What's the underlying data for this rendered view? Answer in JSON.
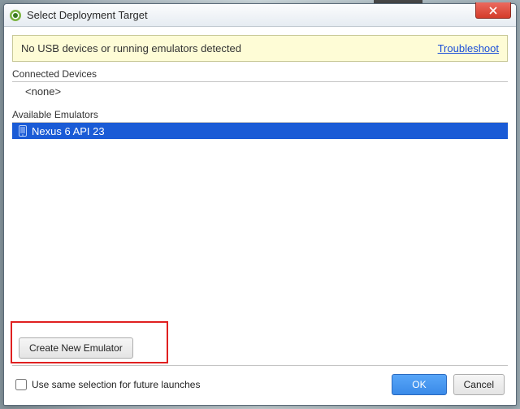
{
  "window": {
    "title": "Select Deployment Target"
  },
  "banner": {
    "message": "No USB devices or running emulators detected",
    "link": "Troubleshoot"
  },
  "sections": {
    "connected": {
      "label": "Connected Devices",
      "none": "<none>"
    },
    "available": {
      "label": "Available Emulators"
    }
  },
  "emulators": [
    {
      "name": "Nexus 6 API 23",
      "selected": true
    }
  ],
  "buttons": {
    "create": "Create New Emulator",
    "ok": "OK",
    "cancel": "Cancel"
  },
  "checkbox": {
    "label": "Use same selection for future launches",
    "checked": false
  }
}
